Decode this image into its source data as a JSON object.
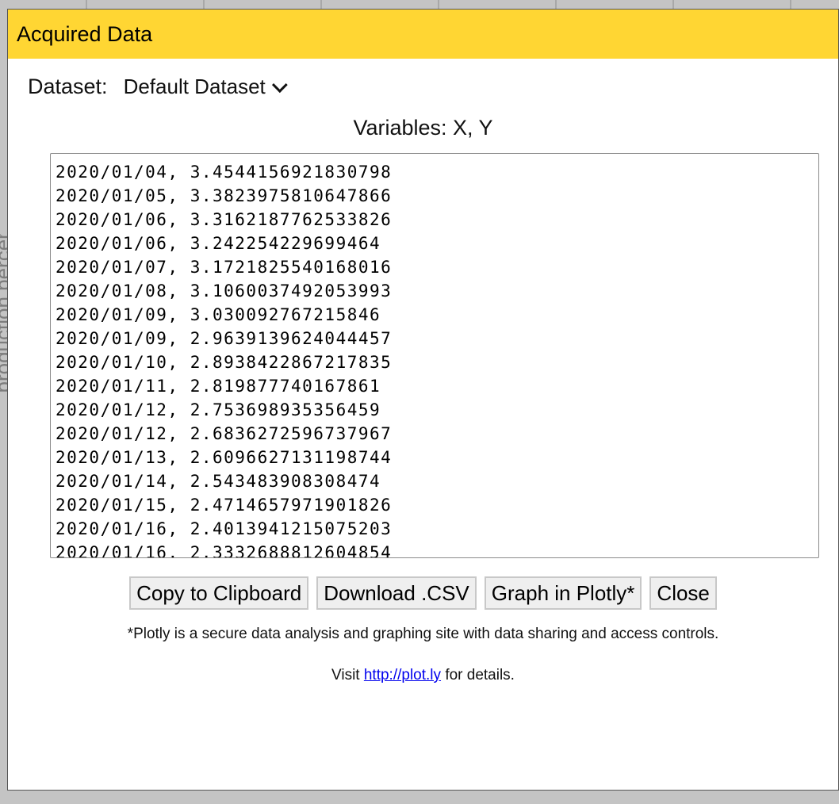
{
  "background": {
    "axis_label": "production percent"
  },
  "dialog": {
    "title": "Acquired Data",
    "dataset_label": "Dataset:",
    "dataset_value": "Default Dataset",
    "variables": "Variables: X, Y",
    "rows": [
      "2020/01/04, 3.4544156921830798",
      "2020/01/05, 3.3823975810647866",
      "2020/01/06, 3.3162187762533826",
      "2020/01/06, 3.242254229699464",
      "2020/01/07, 3.1721825540168016",
      "2020/01/08, 3.1060037492053993",
      "2020/01/09, 3.030092767215846",
      "2020/01/09, 2.9639139624044457",
      "2020/01/10, 2.8938422867217835",
      "2020/01/11, 2.819877740167861",
      "2020/01/12, 2.753698935356459",
      "2020/01/12, 2.6836272596737967",
      "2020/01/13, 2.6096627131198744",
      "2020/01/14, 2.543483908308474",
      "2020/01/15, 2.4714657971901826",
      "2020/01/16, 2.4013941215075203",
      "2020/01/16, 2.3332688812604854"
    ],
    "buttons": {
      "copy": "Copy to Clipboard",
      "download": "Download .CSV",
      "plotly": "Graph in Plotly*",
      "close": "Close"
    },
    "note": "*Plotly is a secure data analysis and graphing site with data sharing and access controls.",
    "visit_prefix": "Visit",
    "visit_link": "http://plot.ly",
    "visit_suffix": "for details.",
    "colors": {
      "titlebar": "#ffd633",
      "link": "#0000ee"
    }
  }
}
